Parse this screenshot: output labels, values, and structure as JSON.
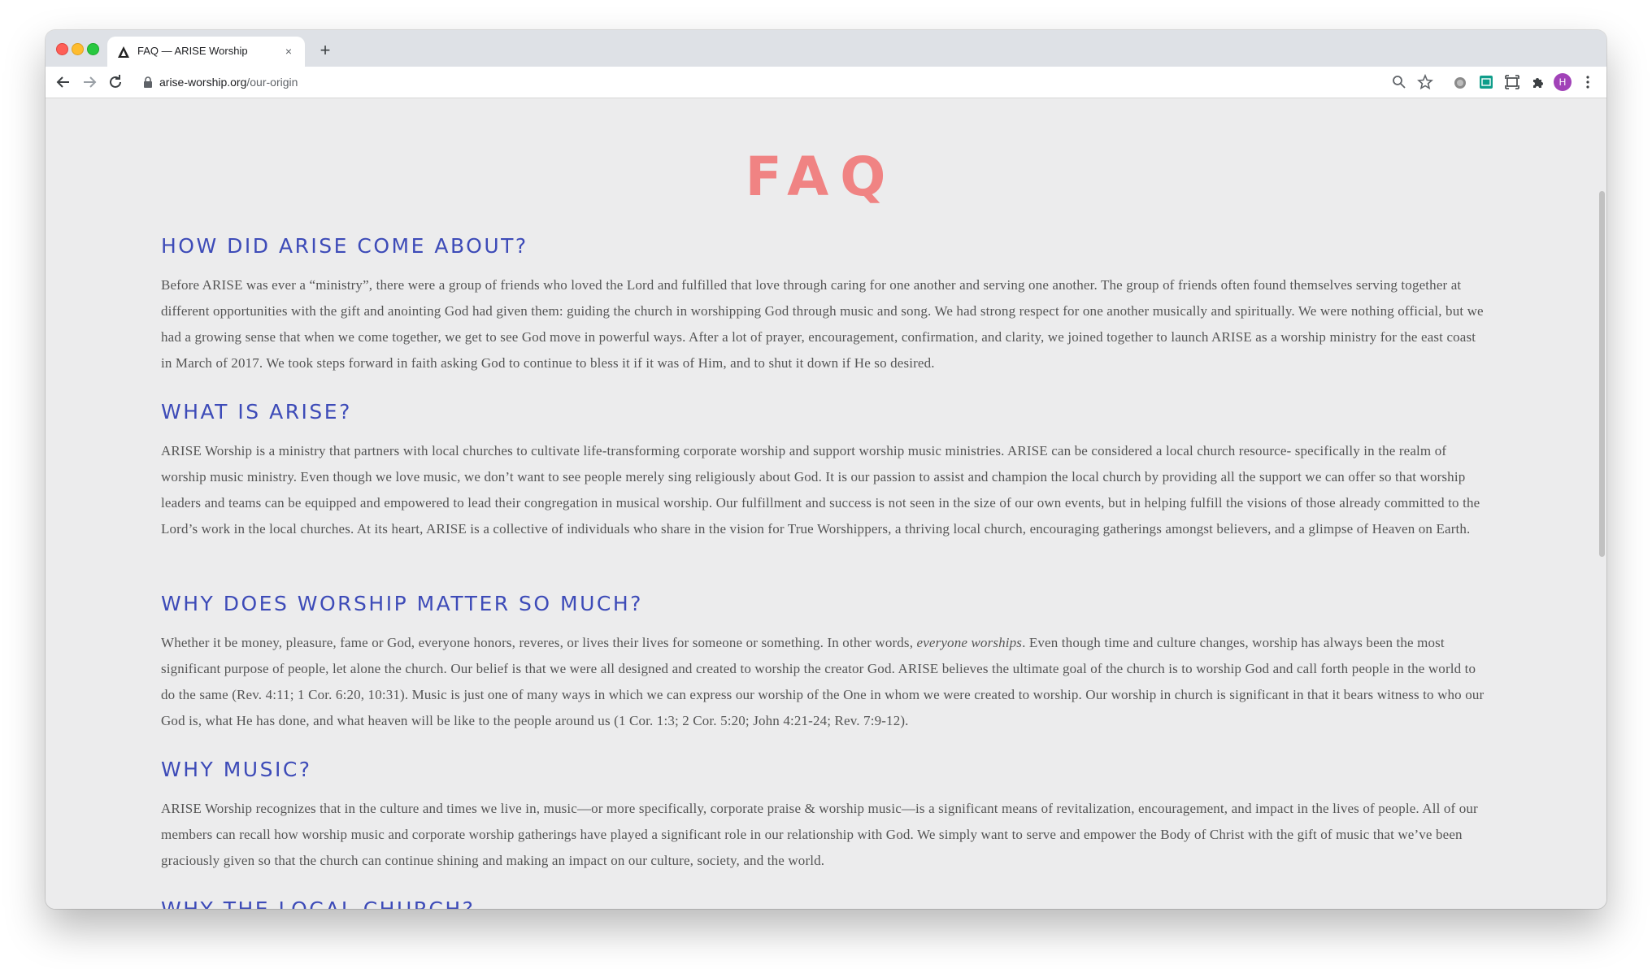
{
  "browser": {
    "tab_title": "FAQ — ARISE Worship",
    "tab_close": "×",
    "new_tab": "+",
    "url_host": "arise-worship.org",
    "url_path": "/our-origin",
    "profile_initial": "H",
    "icons": [
      "back-icon",
      "forward-icon",
      "reload-icon",
      "lock-icon",
      "zoom-icon",
      "bookmark-star-icon",
      "extension-icon",
      "sheets-extension-icon",
      "screenshot-icon",
      "puzzle-icon",
      "menu-icon"
    ]
  },
  "page": {
    "title": "FAQ",
    "title_color": "#f08383",
    "heading_color": "#3d4bb8",
    "sections": [
      {
        "heading": "HOW DID ARISE COME ABOUT?",
        "body": "Before ARISE was ever a “ministry”, there were a group of friends who loved the Lord and fulfilled that love through caring for one another and serving one another. The group of friends often found themselves serving together at different opportunities with the gift and anointing God had given them: guiding the church in worshipping God through music and song. We had strong respect for one another musically and spiritually. We were nothing official, but we had a growing sense that when we come together, we get to see God move in powerful ways. After a lot of prayer, encouragement, confirmation, and clarity, we joined together to launch ARISE as a worship ministry for the east coast in March of 2017. We took steps forward in faith asking God to continue to bless it if it was of Him, and to shut it down if He so desired."
      },
      {
        "heading": "WHAT IS ARISE?",
        "body": "ARISE Worship is a ministry that partners with local churches to cultivate life-transforming corporate worship and support worship music ministries. ARISE can be considered a local church resource- specifically in the realm of worship music ministry. Even though we love music, we don’t want to see people merely sing religiously about God. It is our passion to assist and champion the local church by providing all the support we can offer so that worship leaders and teams can be equipped and empowered to lead their congregation in musical worship. Our fulfillment and success is not seen in the size of our own events, but in helping fulfill the visions of those already committed to the Lord’s work in the local churches. At its heart, ARISE is a collective of individuals who share in the vision for True Worshippers, a thriving local church, encouraging gatherings amongst believers, and a glimpse of Heaven on Earth."
      },
      {
        "heading": "WHY DOES WORSHIP MATTER SO MUCH?",
        "body_before": "Whether it be money, pleasure, fame or God, everyone honors, reveres, or lives their lives for someone or something. In other words, ",
        "body_emphasis": "everyone worships",
        "body_after": ". Even though time and culture changes, worship has always been the most significant purpose of people, let alone the church. Our belief is that we were all designed and created to worship the creator God. ARISE believes the ultimate goal of the church is to worship God and call forth people in the world to do the same (Rev. 4:11; 1 Cor. 6:20, 10:31). Music is just one of many ways in which we can express our worship of the One in whom we were created to worship. Our worship in church is significant in that it bears witness to who our God is, what He has done, and what heaven will be like to the people around us (1 Cor. 1:3; 2 Cor. 5:20; John 4:21-24; Rev. 7:9-12)."
      },
      {
        "heading": "WHY MUSIC?",
        "body": "ARISE Worship recognizes that in the culture and times we live in, music—or more specifically, corporate praise & worship music—is a significant means of revitalization, encouragement, and impact in the lives of people. All of our members can recall how worship music and corporate worship gatherings have played a significant role in our relationship with God. We simply want to serve and empower the Body of Christ with the gift of music that we’ve been graciously given so that the church can continue shining and making an impact on our culture, society, and the world."
      },
      {
        "heading": "WHY THE LOCAL CHURCH?"
      }
    ]
  }
}
